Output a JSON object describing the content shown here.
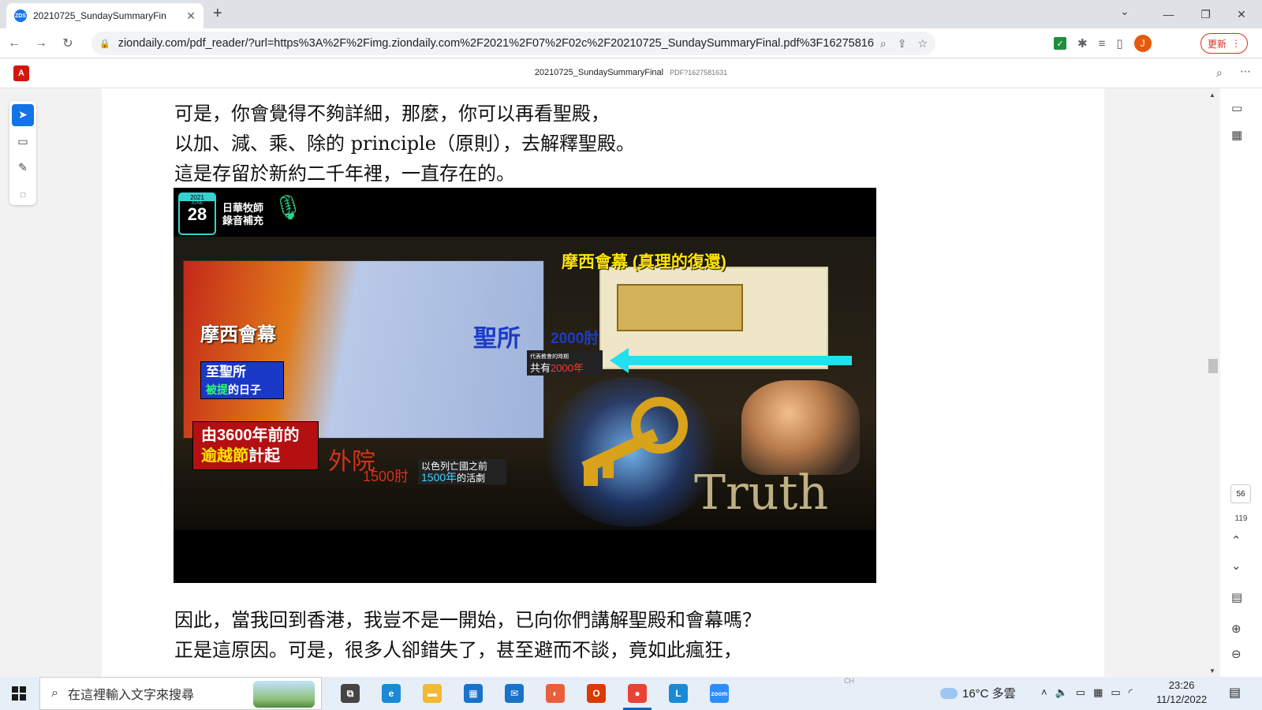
{
  "browser": {
    "tab_title": "20210725_SundaySummaryFin",
    "tab_favicon": "ZDS",
    "tab_close": "✕",
    "new_tab": "+",
    "url": "ziondaily.com/pdf_reader/?url=https%3A%2F%2Fimg.ziondaily.com%2F2021%2F07%2F02c%2F20210725_SundaySummaryFinal.pdf%3F1627581631",
    "profile_initial": "J",
    "update_label": "更新",
    "window_controls": [
      "⌄",
      "—",
      "❐",
      "✕"
    ]
  },
  "pdf": {
    "title": "20210725_SundaySummaryFinal",
    "subtitle": "PDF?1627581631",
    "current_page": "56",
    "total_pages": "119",
    "text_top": [
      "可是，你會覺得不夠詳細，那麼，你可以再看聖殿，",
      "以加、減、乘、除的 principle（原則），去解釋聖殿。",
      "這是存留於新約二千年裡，一直存在的。"
    ],
    "text_bottom": [
      "因此，當我回到香港，我豈不是一開始，已向你們講解聖殿和會幕嗎？",
      "正是這原因。可是，很多人卻錯失了，甚至避而不談，竟如此瘋狂，"
    ]
  },
  "slide": {
    "date_year": "2021",
    "date_month": "JUNE",
    "date_day": "28",
    "badge_line1": "日華牧師",
    "badge_line2": "錄音補充",
    "title_right": "摩西會幕 (真理的復還)",
    "tabernacle_label": "摩西會幕",
    "holy_of_holies": "至聖所",
    "raptured_day_1": "被提",
    "raptured_day_2": "的日子",
    "passover_1": "由3600年前的",
    "passover_2": "逾越節",
    "passover_3": "計起",
    "holy_place": "聖所",
    "holy_place_num": "2000肘",
    "church_time": "代表教會的時期",
    "total_2000_1": "共有",
    "total_2000_2": "2000年",
    "outer_court": "外院",
    "outer_court_num": "1500肘",
    "israel_1": "以色列亡國之前",
    "israel_2": "1500年",
    "israel_3": "的活劇",
    "truth": "Truth"
  },
  "taskbar": {
    "search_placeholder": "在這裡輸入文字來搜尋",
    "weather": "16°C 多雲",
    "time": "23:26",
    "date": "11/12/2022",
    "ime_hint": "CH",
    "apps": [
      {
        "name": "task-view",
        "label": "⧉",
        "color": "#444444"
      },
      {
        "name": "edge",
        "label": "e",
        "color": "#1b8ad6"
      },
      {
        "name": "file-explorer",
        "label": "▬",
        "color": "#f2b933"
      },
      {
        "name": "store",
        "label": "▦",
        "color": "#1a73c8"
      },
      {
        "name": "mail",
        "label": "✉",
        "color": "#1a73c8"
      },
      {
        "name": "photos-app",
        "label": "◐",
        "color": "#e8603a"
      },
      {
        "name": "office",
        "label": "O",
        "color": "#d83b01"
      },
      {
        "name": "chrome",
        "label": "●",
        "color": "#ea4335"
      },
      {
        "name": "l-app",
        "label": "L",
        "color": "#1a8ad6"
      },
      {
        "name": "zoom",
        "label": "zoom",
        "color": "#2d8cff"
      }
    ]
  }
}
